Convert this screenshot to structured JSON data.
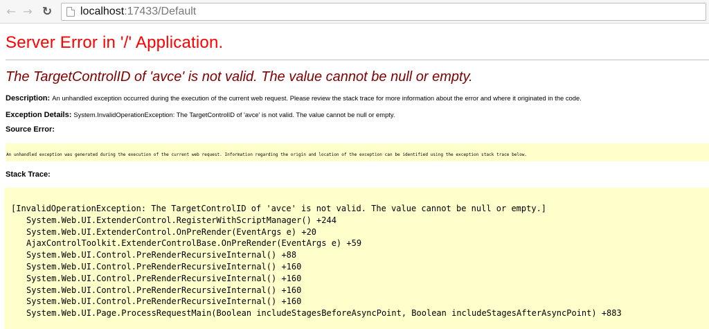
{
  "browser": {
    "url_host": "localhost",
    "url_rest": ":17433/Default"
  },
  "page": {
    "title": "Server Error in '/' Application.",
    "subtitle": "The TargetControlID of 'avce' is not valid. The value cannot be null or empty.",
    "description_label": "Description:",
    "description_text": "An unhandled exception occurred during the execution of the current web request. Please review the stack trace for more information about the error and where it originated in the code.",
    "exception_label": "Exception Details:",
    "exception_text": "System.InvalidOperationException: The TargetControlID of 'avce' is not valid. The value cannot be null or empty.",
    "source_error_label": "Source Error:",
    "source_error_text": "An unhandled exception was generated during the execution of the current web request. Information regarding the origin and location of the exception can be identified using the exception stack trace below.",
    "stack_trace_label": "Stack Trace:",
    "stack_header": "[InvalidOperationException: The TargetControlID of 'avce' is not valid. The value cannot be null or empty.]",
    "stack_frames": [
      "System.Web.UI.ExtenderControl.RegisterWithScriptManager() +244",
      "System.Web.UI.ExtenderControl.OnPreRender(EventArgs e) +20",
      "AjaxControlToolkit.ExtenderControlBase.OnPreRender(EventArgs e) +59",
      "System.Web.UI.Control.PreRenderRecursiveInternal() +88",
      "System.Web.UI.Control.PreRenderRecursiveInternal() +160",
      "System.Web.UI.Control.PreRenderRecursiveInternal() +160",
      "System.Web.UI.Control.PreRenderRecursiveInternal() +160",
      "System.Web.UI.Control.PreRenderRecursiveInternal() +160",
      "System.Web.UI.Page.ProcessRequestMain(Boolean includeStagesBeforeAsyncPoint, Boolean includeStagesAfterAsyncPoint) +883"
    ]
  }
}
